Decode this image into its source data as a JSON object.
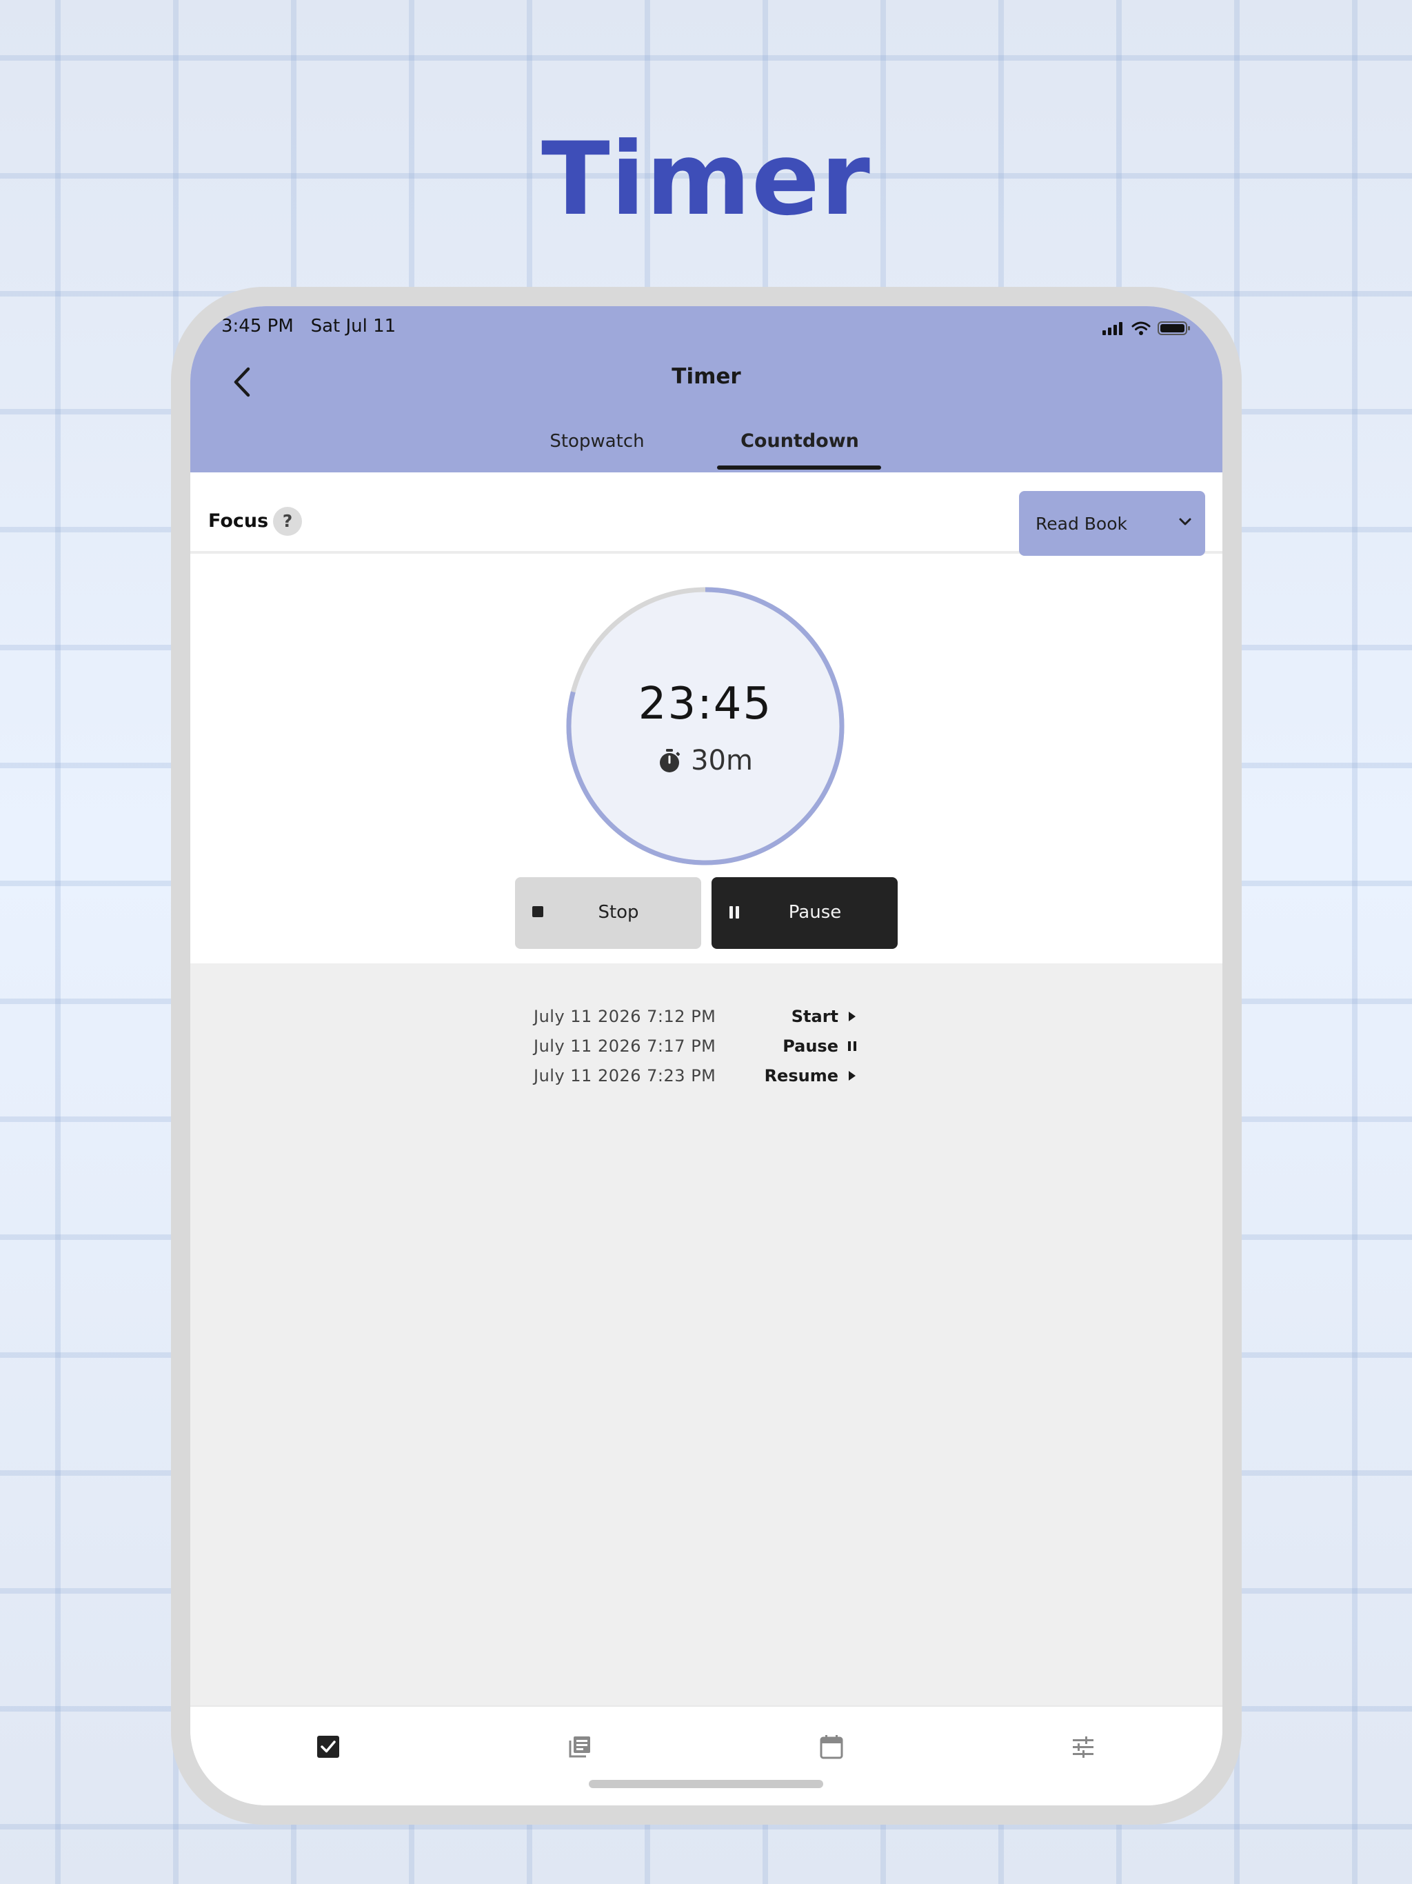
{
  "hero": {
    "title": "Timer"
  },
  "status_bar": {
    "time": "3:45 PM",
    "date": "Sat Jul 11"
  },
  "header": {
    "title": "Timer",
    "tabs": [
      {
        "label": "Stopwatch",
        "selected": false
      },
      {
        "label": "Countdown",
        "selected": true
      }
    ]
  },
  "focus": {
    "label": "Focus",
    "help_symbol": "?",
    "dropdown_value": "Read Book"
  },
  "timer": {
    "remaining": "23:45",
    "duration": "30m",
    "progress_fraction": 0.79,
    "stop_label": "Stop",
    "pause_label": "Pause"
  },
  "log": [
    {
      "time": "July 11 2026 7:12 PM",
      "action": "Start",
      "icon": "play-icon"
    },
    {
      "time": "July 11 2026 7:17 PM",
      "action": "Pause",
      "icon": "pause-icon"
    },
    {
      "time": "July 11 2026 7:23 PM",
      "action": "Resume",
      "icon": "play-icon"
    }
  ],
  "bottom_nav": [
    {
      "name": "tasks",
      "icon": "checkbox-icon",
      "active": true
    },
    {
      "name": "notes",
      "icon": "notes-icon",
      "active": false
    },
    {
      "name": "calendar",
      "icon": "calendar-icon",
      "active": false
    },
    {
      "name": "settings",
      "icon": "sliders-icon",
      "active": false
    }
  ],
  "colors": {
    "accent": "#9ea8da",
    "hero_title": "#3e4eb8",
    "dark_button": "#232323",
    "log_background": "#efefef"
  }
}
